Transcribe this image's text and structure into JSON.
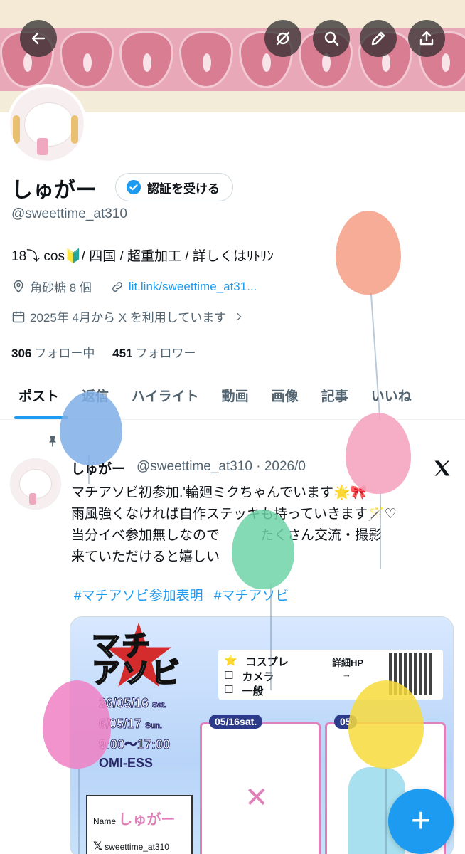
{
  "profile": {
    "name": "しゅがー",
    "verify_label": "認証を受ける",
    "handle": "@sweettime_at310",
    "bio": "18⤵︎ cos🔰/ 四国 / 超重加工 / 詳しくはﾘﾄﾘﾝ",
    "location": "角砂糖 8 個",
    "link": "lit.link/sweettime_at31...",
    "joined": "2025年 4月から X を利用しています",
    "following_count": "306",
    "following_label": "フォロー中",
    "followers_count": "451",
    "followers_label": "フォロワー"
  },
  "header_buttons": [
    "back-icon",
    "no-translate-icon",
    "search-icon",
    "edit-icon",
    "share-icon"
  ],
  "tabs": [
    {
      "label": "ポスト"
    },
    {
      "label": "返信"
    },
    {
      "label": "ハイライト"
    },
    {
      "label": "動画"
    },
    {
      "label": "画像"
    },
    {
      "label": "記事"
    },
    {
      "label": "いいね"
    }
  ],
  "post": {
    "name": "しゅがー",
    "handle_date": "@sweettime_at310 · 2026/0",
    "lines": [
      "マチアソビ初参加.'輪廻ミクちゃんでいます🌟🎀",
      "雨風強くなければ自作ステッキも持っていきます🪄♡",
      "当分イベ参加無しなので　　　たくさん交流・撮影",
      "来ていただけると嬉しい"
    ],
    "hashtags": [
      "#マチアソビ参加表明",
      "#マチアソビ"
    ]
  },
  "image": {
    "logo": "マチ\nアソビ",
    "date1": "26/05/16",
    "date1_day": "Sat.",
    "date2": "6/05/17",
    "date2_day": "Sun.",
    "time": "9:00～17:00",
    "venue": "OMI-ESS",
    "cb1": "コスプレ",
    "cb2": "カメラ",
    "cb3": "一般",
    "detail_label": "詳細HP",
    "arrow": "→",
    "box1_tag": "05/16sat.",
    "box2_tag": "05",
    "card_name_label": "Name",
    "card_name": "しゅがー",
    "card_handle": "sweettime_at310"
  },
  "colors": {
    "accent": "#1d9bf0",
    "text": "#0f1419",
    "muted": "#536471"
  }
}
